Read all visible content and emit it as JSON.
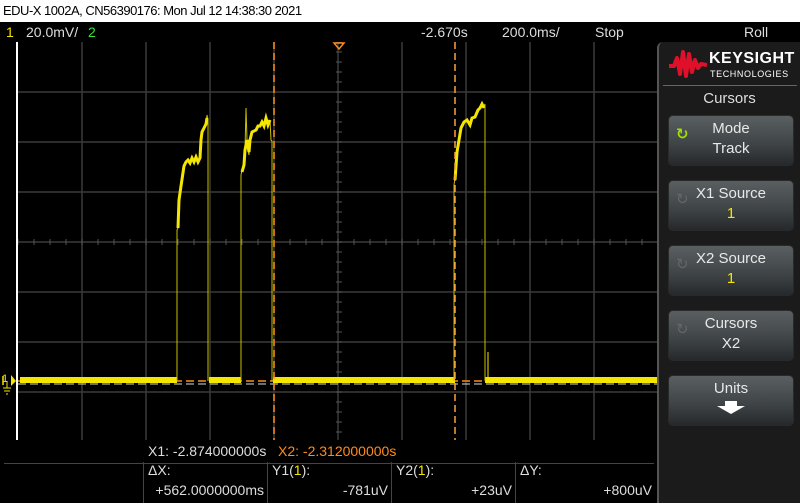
{
  "title": "EDU-X 1002A, CN56390176: Mon Jul 12 14:38:30 2021",
  "status": {
    "ch1_label": "1",
    "ch1_scale": "20.0mV/",
    "ch2_label": "2",
    "time_offset": "-2.670s",
    "time_scale": "200.0ms/",
    "run_state": "Stop",
    "mode": "Roll"
  },
  "colors": {
    "ch1": "#f5e600",
    "ch2": "#3ee03e",
    "cursor": "#ff8c1a",
    "grid": "#3a3a3a"
  },
  "sidebar": {
    "brand": "KEYSIGHT",
    "brand_sub": "TECHNOLOGIES",
    "menu_title": "Cursors",
    "buttons": [
      {
        "label": "Mode",
        "value": "Track",
        "icon": "rotate-icon"
      },
      {
        "label": "X1 Source",
        "value": "1",
        "icon": "rotate-icon"
      },
      {
        "label": "X2 Source",
        "value": "1",
        "icon": "rotate-icon"
      },
      {
        "label": "Cursors",
        "value": "X2",
        "icon": "rotate-icon"
      },
      {
        "label": "Units",
        "value": "",
        "icon": "arrow-down-icon"
      }
    ]
  },
  "readout": {
    "x1": "X1: -2.874000000s",
    "x2": "X2: -2.312000000s",
    "dx_label": "ΔX:",
    "dx_value": "+562.0000000ms",
    "y1_label_pre": "Y1(",
    "y1_ch": "1",
    "y1_label_post": "):",
    "y1_value": "-781uV",
    "y2_label_pre": "Y2(",
    "y2_ch": "1",
    "y2_label_post": "):",
    "y2_value": "+23uV",
    "dy_label": "ΔY:",
    "dy_value": "+800uV"
  }
}
